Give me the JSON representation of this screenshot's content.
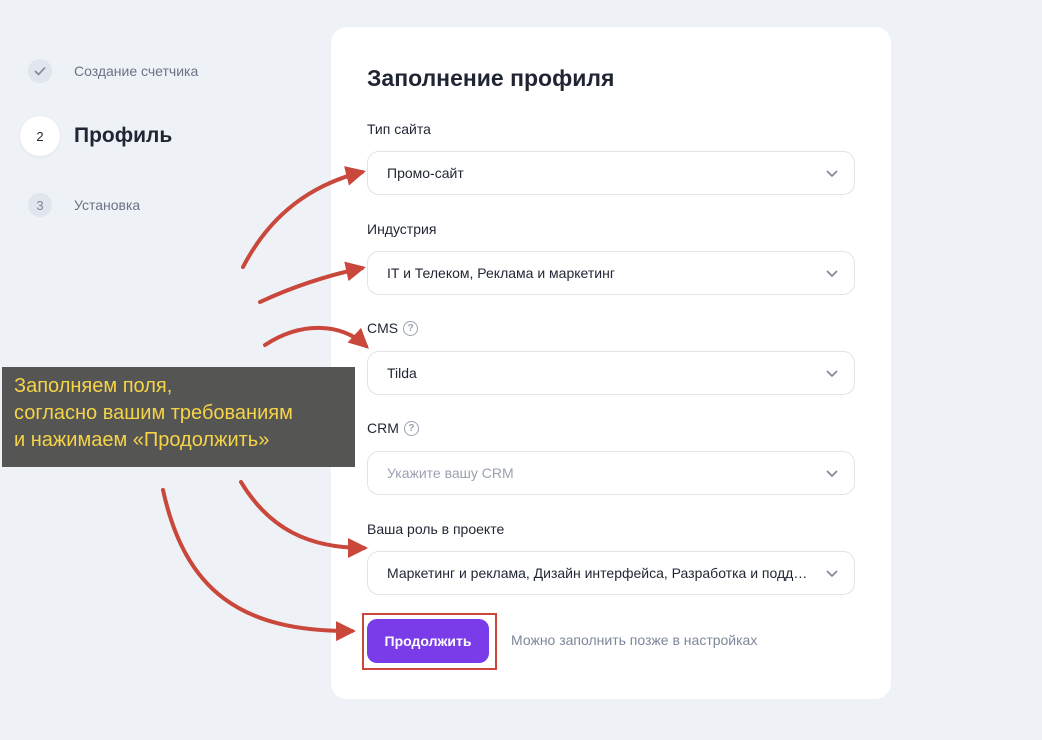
{
  "steps": [
    {
      "number": "",
      "label": "Создание счетчика",
      "state": "done",
      "icon": "check-icon"
    },
    {
      "number": "2",
      "label": "Профиль",
      "state": "active"
    },
    {
      "number": "3",
      "label": "Установка",
      "state": "todo"
    }
  ],
  "form": {
    "title": "Заполнение профиля",
    "site_type": {
      "label": "Тип сайта",
      "value": "Промо-сайт"
    },
    "industry": {
      "label": "Индустрия",
      "value": "IT и Телеком, Реклама и маркетинг"
    },
    "cms": {
      "label": "CMS",
      "value": "Tilda"
    },
    "crm": {
      "label": "CRM",
      "placeholder": "Укажите вашу CRM"
    },
    "role": {
      "label": "Ваша роль в проекте",
      "value": "Маркетинг и реклама, Дизайн интерфейса, Разработка и поддержка"
    },
    "continue_label": "Продолжить",
    "later_text": "Можно заполнить позже в настройках",
    "help_glyph": "?"
  },
  "annotation": {
    "lines": [
      "Заполняем поля,",
      "согласно вашим требованиям",
      "и нажимаем «Продолжить»"
    ],
    "text_color": "#f5d448",
    "box_color": "#555554",
    "arrow_color": "#c9473b"
  },
  "colors": {
    "accent": "#7a3ce8",
    "background": "#eef1f6"
  }
}
